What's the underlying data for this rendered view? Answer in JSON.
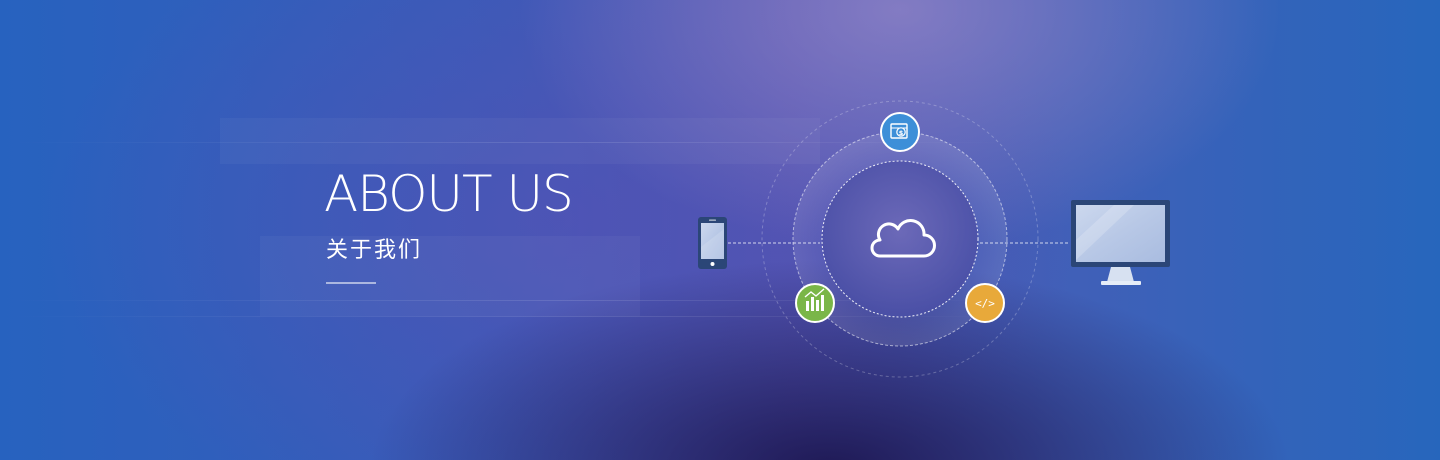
{
  "hero": {
    "title": "ABOUT US",
    "subtitle": "关于我们"
  },
  "icons": {
    "center": "cloud-icon",
    "left_device": "phone-icon",
    "right_device": "monitor-icon",
    "badge_top": "money-icon",
    "badge_left": "chart-icon",
    "badge_right": "code-icon",
    "badge_right_glyph": "</>"
  },
  "colors": {
    "badge_top": "#3d8fd8",
    "badge_left": "#7ab648",
    "badge_right": "#e8a93a",
    "device": "#2b4677",
    "screen": "#c3d1ea"
  }
}
